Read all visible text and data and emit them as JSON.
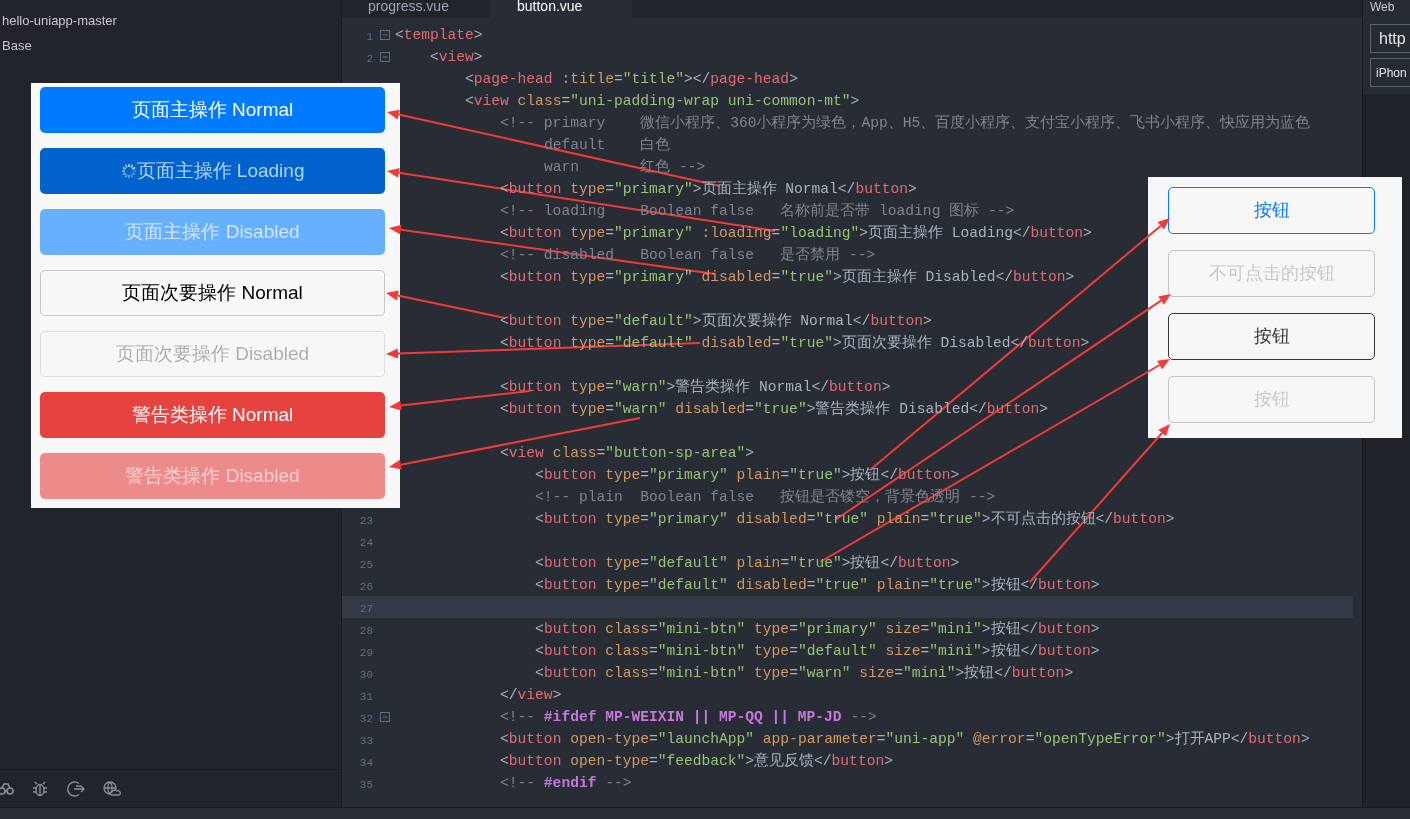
{
  "sidebar": {
    "items": [
      {
        "label": "hello-uniapp-master"
      },
      {
        "label": "Base"
      }
    ]
  },
  "tabs": [
    {
      "label": "progress.vue",
      "selected": false
    },
    {
      "label": "button.vue",
      "selected": true
    }
  ],
  "code_lines": [
    {
      "number": "1",
      "foldable": true,
      "current": false,
      "text": "<template>"
    },
    {
      "number": "2",
      "foldable": true,
      "current": false,
      "text": "    <view>"
    },
    {
      "foldable": false,
      "current": false,
      "text": "        <page-head :title=\"title\"></page-head>"
    },
    {
      "foldable": false,
      "current": false,
      "text": "        <view class=\"uni-padding-wrap uni-common-mt\">"
    },
    {
      "foldable": false,
      "current": false,
      "text": "            <!-- primary    微信小程序、360小程序为绿色，App、H5、百度小程序、支付宝小程序、飞书小程序、快应用为蓝色"
    },
    {
      "foldable": false,
      "current": false,
      "text": "                 default    白色"
    },
    {
      "foldable": false,
      "current": false,
      "text": "                 warn       红色 -->"
    },
    {
      "foldable": false,
      "current": false,
      "text": "            <button type=\"primary\">页面主操作 Normal</button>"
    },
    {
      "foldable": false,
      "current": false,
      "text": "            <!-- loading    Boolean false   名称前是否带 loading 图标 -->"
    },
    {
      "foldable": false,
      "current": false,
      "text": "            <button type=\"primary\" :loading=\"loading\">页面主操作 Loading</button>"
    },
    {
      "foldable": false,
      "current": false,
      "text": "            <!-- disabled   Boolean false   是否禁用 -->"
    },
    {
      "foldable": false,
      "current": false,
      "text": "            <button type=\"primary\" disabled=\"true\">页面主操作 Disabled</button>"
    },
    {
      "foldable": false,
      "current": false
    },
    {
      "foldable": false,
      "current": false,
      "text": "            <button type=\"default\">页面次要操作 Normal</button>"
    },
    {
      "foldable": false,
      "current": false,
      "text": "            <button type=\"default\" disabled=\"true\">页面次要操作 Disabled</button>"
    },
    {
      "foldable": false,
      "current": false
    },
    {
      "foldable": false,
      "current": false,
      "text": "            <button type=\"warn\">警告类操作 Normal</button>"
    },
    {
      "foldable": false,
      "current": false,
      "text": "            <button type=\"warn\" disabled=\"true\">警告类操作 Disabled</button>"
    },
    {
      "foldable": false,
      "current": false
    },
    {
      "foldable": false,
      "current": false,
      "text": "            <view class=\"button-sp-area\">"
    },
    {
      "foldable": false,
      "current": false,
      "text": "                <button type=\"primary\" plain=\"true\">按钮</button>"
    },
    {
      "foldable": false,
      "current": false,
      "text": "                <!-- plain  Boolean false   按钮是否镂空，背景色透明 -->"
    },
    {
      "number": "23",
      "foldable": false,
      "current": false,
      "text": "                <button type=\"primary\" disabled=\"true\" plain=\"true\">不可点击的按钮</button>"
    },
    {
      "number": "24",
      "foldable": false,
      "current": false
    },
    {
      "number": "25",
      "foldable": false,
      "current": false,
      "text": "                <button type=\"default\" plain=\"true\">按钮</button>"
    },
    {
      "number": "26",
      "foldable": false,
      "current": false,
      "text": "                <button type=\"default\" disabled=\"true\" plain=\"true\">按钮</button>"
    },
    {
      "number": "27",
      "foldable": false,
      "current": true
    },
    {
      "number": "28",
      "foldable": false,
      "current": false,
      "text": "                <button class=\"mini-btn\" type=\"primary\" size=\"mini\">按钮</button>"
    },
    {
      "number": "29",
      "foldable": false,
      "current": false,
      "text": "                <button class=\"mini-btn\" type=\"default\" size=\"mini\">按钮</button>"
    },
    {
      "number": "30",
      "foldable": false,
      "current": false,
      "text": "                <button class=\"mini-btn\" type=\"warn\" size=\"mini\">按钮</button>"
    },
    {
      "number": "31",
      "foldable": false,
      "current": false,
      "text": "            </view>"
    },
    {
      "number": "32",
      "foldable": true,
      "current": false,
      "kind": "directive",
      "text": "            <!-- #ifdef MP-WEIXIN || MP-QQ || MP-JD -->"
    },
    {
      "number": "33",
      "foldable": false,
      "current": false,
      "text": "            <button open-type=\"launchApp\" app-parameter=\"uni-app\" @error=\"openTypeError\">打开APP</button>"
    },
    {
      "number": "34",
      "foldable": false,
      "current": false,
      "text": "            <button open-type=\"feedback\">意见反馈</button>"
    },
    {
      "number": "35",
      "foldable": false,
      "current": false,
      "kind": "directive",
      "text": "            <!-- #endif -->"
    }
  ],
  "preview_buttons": [
    {
      "label": "页面主操作 Normal",
      "kind": "primary",
      "loading": false,
      "disabled": false
    },
    {
      "label": "页面主操作 Loading",
      "kind": "primary",
      "loading": true,
      "disabled": false
    },
    {
      "label": "页面主操作 Disabled",
      "kind": "primary",
      "loading": false,
      "disabled": true
    },
    {
      "label": "页面次要操作 Normal",
      "kind": "default",
      "loading": false,
      "disabled": false
    },
    {
      "label": "页面次要操作 Disabled",
      "kind": "default",
      "loading": false,
      "disabled": true
    },
    {
      "label": "警告类操作 Normal",
      "kind": "warn",
      "loading": false,
      "disabled": false
    },
    {
      "label": "警告类操作 Disabled",
      "kind": "warn",
      "loading": false,
      "disabled": true
    }
  ],
  "plain_buttons": [
    {
      "label": "按钮",
      "kind": "primary",
      "disabled": false
    },
    {
      "label": "不可点击的按钮",
      "kind": "primary",
      "disabled": true
    },
    {
      "label": "按钮",
      "kind": "default",
      "disabled": false
    },
    {
      "label": "按钮",
      "kind": "default",
      "disabled": true
    }
  ],
  "right_panel": {
    "title": "Web",
    "url": "http",
    "device": "iPhon"
  }
}
